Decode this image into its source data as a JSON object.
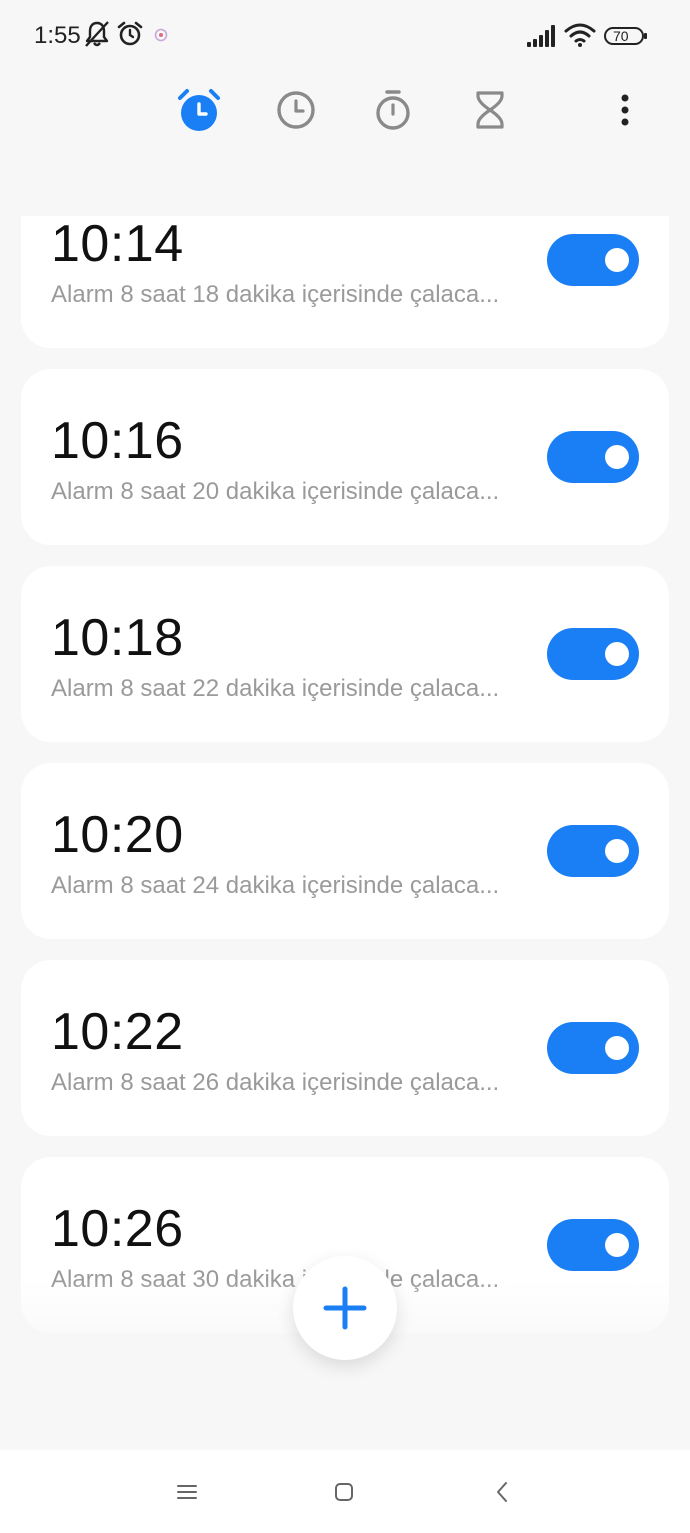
{
  "status_bar": {
    "time": "1:55",
    "battery": "70",
    "icons": [
      "notifications-off-icon",
      "alarm-icon",
      "app-notification-icon",
      "signal-icon",
      "wifi-icon",
      "battery-icon"
    ]
  },
  "top_nav": {
    "tabs": [
      {
        "name": "alarm-icon",
        "active": true
      },
      {
        "name": "clock-icon",
        "active": false
      },
      {
        "name": "stopwatch-icon",
        "active": false
      },
      {
        "name": "timer-icon",
        "active": false
      }
    ],
    "more": "more-options-icon"
  },
  "alarms": [
    {
      "time": "10:14",
      "description": "Alarm 8 saat 18 dakika içerisinde çalaca...",
      "enabled": true
    },
    {
      "time": "10:16",
      "description": "Alarm 8 saat 20 dakika içerisinde çalaca...",
      "enabled": true
    },
    {
      "time": "10:18",
      "description": "Alarm 8 saat 22 dakika içerisinde çalaca...",
      "enabled": true
    },
    {
      "time": "10:20",
      "description": "Alarm 8 saat 24 dakika içerisinde çalaca...",
      "enabled": true
    },
    {
      "time": "10:22",
      "description": "Alarm 8 saat 26 dakika içerisinde çalaca...",
      "enabled": true
    },
    {
      "time": "10:26",
      "description": "Alarm 8 saat 30 dakika içerisinde çalaca...",
      "enabled": true
    }
  ],
  "fab": {
    "icon": "plus-icon"
  },
  "system_nav": [
    "menu-icon",
    "home-icon",
    "back-icon"
  ],
  "colors": {
    "accent": "#1a7ff5",
    "icon_inactive": "#8a8a8a",
    "background": "#f7f7f7",
    "card": "#ffffff"
  }
}
